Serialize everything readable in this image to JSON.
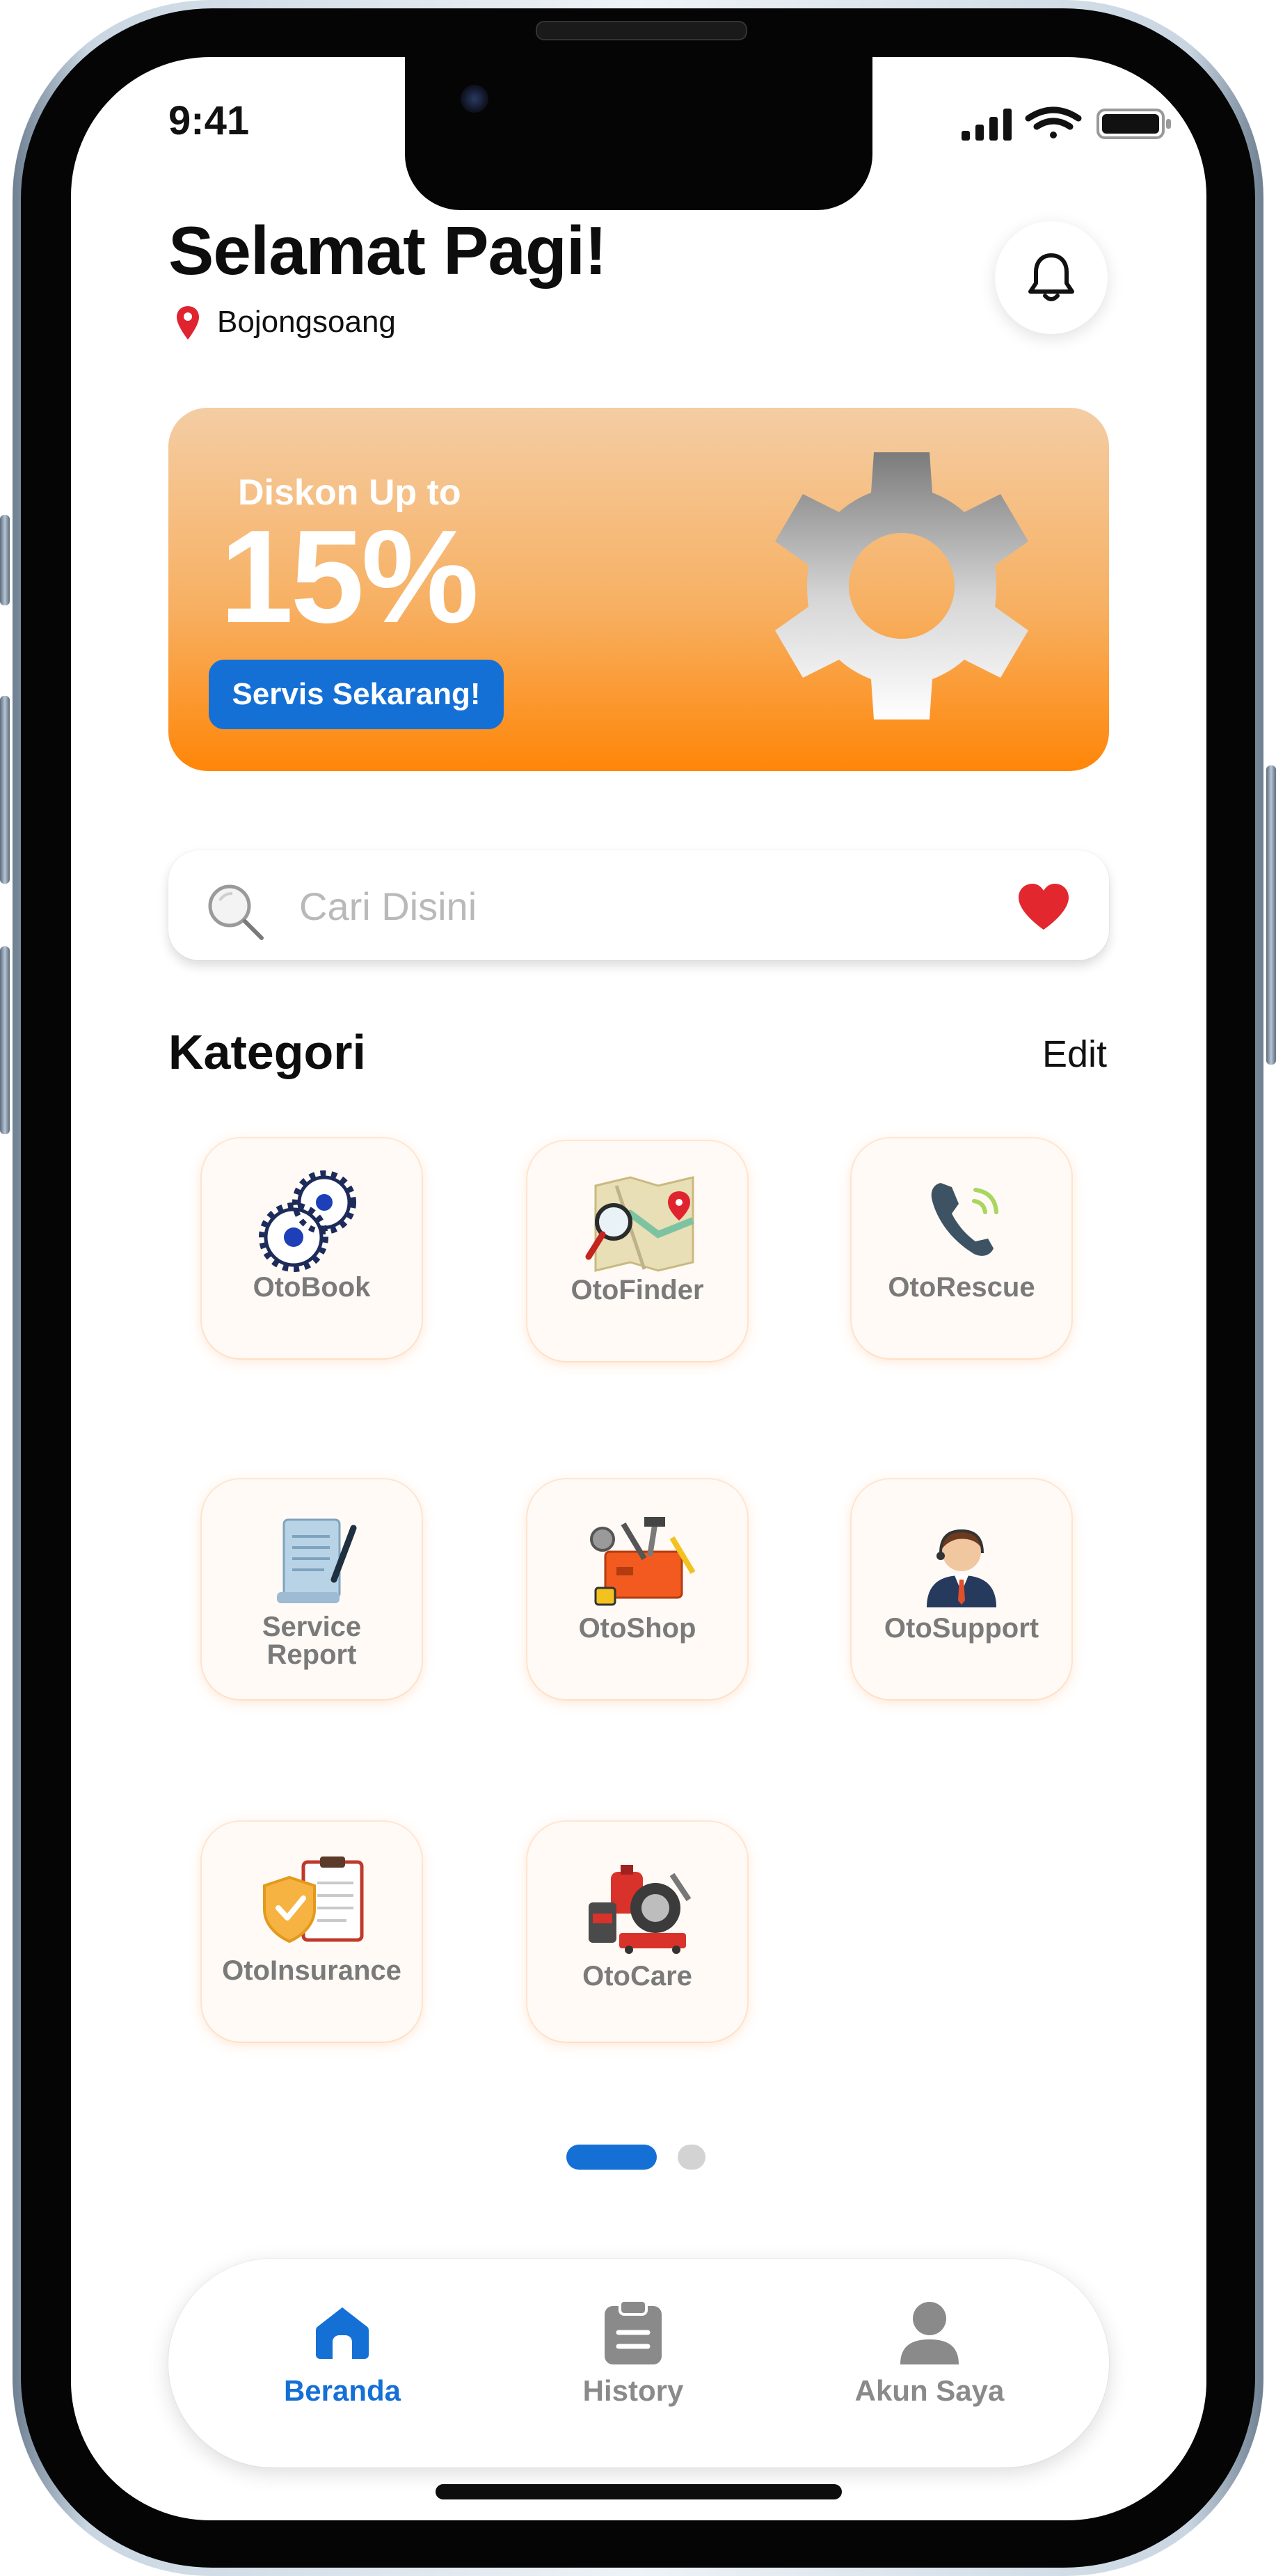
{
  "status_bar": {
    "time": "9:41"
  },
  "header": {
    "greeting": "Selamat Pagi!",
    "location": "Bojongsoang",
    "location_icon": "map-pin-icon",
    "notification_icon": "bell-icon"
  },
  "banner": {
    "subtitle": "Diskon Up to",
    "percent": "15%",
    "cta_label": "Servis Sekarang!",
    "icon": "gear-icon",
    "colors": {
      "top": "#f4cda4",
      "bottom": "#ff8608",
      "button": "#1570d6"
    }
  },
  "search": {
    "placeholder": "Cari Disini",
    "value": "",
    "icon": "search-icon",
    "favorite_icon": "heart-icon"
  },
  "kategori": {
    "title": "Kategori",
    "edit_label": "Edit",
    "items": [
      {
        "label": "OtoBook",
        "icon": "gears-icon"
      },
      {
        "label": "OtoFinder",
        "icon": "map-search-icon"
      },
      {
        "label": "OtoRescue",
        "icon": "phone-call-icon"
      },
      {
        "label": "Service Report",
        "icon": "document-pen-icon"
      },
      {
        "label": "OtoShop",
        "icon": "toolbox-icon"
      },
      {
        "label": "OtoSupport",
        "icon": "support-agent-icon"
      },
      {
        "label": "OtoInsurance",
        "icon": "insurance-shield-icon"
      },
      {
        "label": "OtoCare",
        "icon": "car-care-icon"
      }
    ]
  },
  "pagination": {
    "pages": 2,
    "current": 1
  },
  "bottom_nav": {
    "items": [
      {
        "label": "Beranda",
        "icon": "home-icon",
        "active": true
      },
      {
        "label": "History",
        "icon": "clipboard-icon",
        "active": false
      },
      {
        "label": "Akun Saya",
        "icon": "user-icon",
        "active": false
      }
    ],
    "colors": {
      "active": "#1570d6",
      "inactive": "#8a8a8a"
    }
  }
}
